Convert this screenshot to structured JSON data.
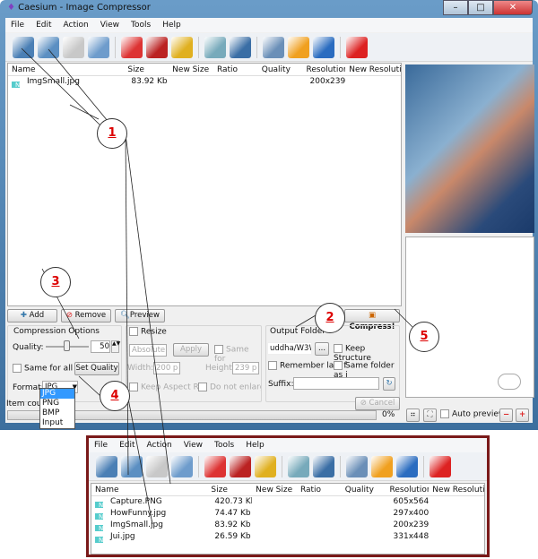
{
  "window": {
    "title": "Caesium - Image Compressor",
    "minimize": "–",
    "maximize": "□",
    "close": "✕"
  },
  "menu": [
    "File",
    "Edit",
    "Action",
    "View",
    "Tools",
    "Help"
  ],
  "toolbar": [
    {
      "icon": "open-file-icon",
      "color": "#4a7fb5"
    },
    {
      "icon": "open-folder-icon",
      "color": "#5b8fc2"
    },
    {
      "icon": "save-list-icon",
      "color": "#c8c8c8"
    },
    {
      "icon": "import-list-icon",
      "color": "#6e9ccc"
    },
    {
      "icon": "remove-item-icon",
      "color": "#d33"
    },
    {
      "icon": "clear-list-icon",
      "color": "#b22"
    },
    {
      "icon": "broom-icon",
      "color": "#e0b020"
    },
    {
      "icon": "search-icon",
      "color": "#7ab"
    },
    {
      "icon": "preview-image-icon",
      "color": "#3a6ea5"
    },
    {
      "icon": "settings-tools-icon",
      "color": "#6a8fb8"
    },
    {
      "icon": "update-gear-icon",
      "color": "#f0a020"
    },
    {
      "icon": "info-icon",
      "color": "#2a6cc0"
    },
    {
      "icon": "power-icon",
      "color": "#d22"
    }
  ],
  "columns": [
    "Name",
    "Size",
    "New Size",
    "Ratio",
    "Quality",
    "Resolution",
    "New Resolutio"
  ],
  "files": [
    {
      "name": "ImgSmall.jpg",
      "size": "83.92 Kb",
      "resolution": "200x239"
    }
  ],
  "buttons": {
    "add": "Add",
    "remove": "Remove",
    "preview": "Preview",
    "compress": "Compress!",
    "cancel": "Cancel"
  },
  "compression": {
    "title": "Compression Options",
    "quality_label": "Quality:",
    "quality": 50,
    "same_for_all": "Same for all",
    "set_quality": "Set Quality",
    "format_label": "Format:",
    "format": "JPG",
    "format_options": [
      "JPG",
      "PNG",
      "BMP",
      "Input"
    ]
  },
  "resize": {
    "title": "Resize",
    "mode": "Absolute",
    "apply": "Apply",
    "same_for": "Same for",
    "width_label": "Width:",
    "width": "200 p",
    "height_label": "Height:",
    "height": "239 p",
    "keep_aspect": "Keep Aspect Ra",
    "no_enlarge": "Do not enlarge i"
  },
  "output": {
    "title": "Output Folder",
    "path": "uddha/W3W",
    "browse": "...",
    "keep_structure": "Keep Structure",
    "remember": "Remember last f",
    "same_folder": "Same folder as i",
    "suffix_label": "Suffix:",
    "suffix": ""
  },
  "status": {
    "item_count": "Item count",
    "progress": "0%",
    "progress_value": 0
  },
  "preview": {
    "auto_preview": "Auto preview"
  },
  "annotations": [
    "1",
    "2",
    "3",
    "4",
    "5"
  ],
  "inset": {
    "menu": [
      "File",
      "Edit",
      "Action",
      "View",
      "Tools",
      "Help"
    ],
    "files": [
      {
        "name": "Capture.PNG",
        "size": "420.73 Kb",
        "resolution": "605x564"
      },
      {
        "name": "HowFunny.jpg",
        "size": "74.47 Kb",
        "resolution": "297x400"
      },
      {
        "name": "ImgSmall.jpg",
        "size": "83.92 Kb",
        "resolution": "200x239"
      },
      {
        "name": "Jui.jpg",
        "size": "26.59 Kb",
        "resolution": "331x448"
      }
    ]
  }
}
